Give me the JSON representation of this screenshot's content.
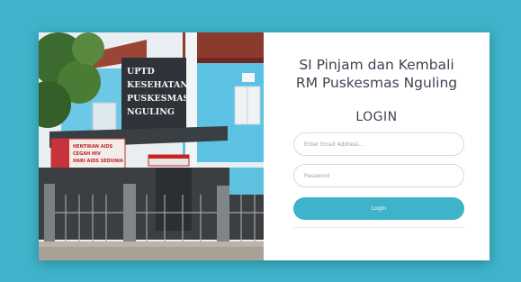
{
  "photo": {
    "sign_lines": [
      "UPTD",
      "KESEHATAN",
      "PUSKESMAS",
      "NGULING"
    ],
    "banner_lines": [
      "HENTIKAN AIDS",
      "CEGAH HIV",
      "HARI AIDS SEDUNIA"
    ]
  },
  "login_panel": {
    "title_line1": "SI Pinjam dan Kembali",
    "title_line2": "RM Puskesmas Nguling",
    "heading": "LOGIN",
    "email_placeholder": "Enter Email Address...",
    "password_placeholder": "Password",
    "login_button_label": "Login"
  },
  "colors": {
    "background": "#3eb3c9",
    "accent": "#3eb3c9",
    "card": "#ffffff"
  }
}
